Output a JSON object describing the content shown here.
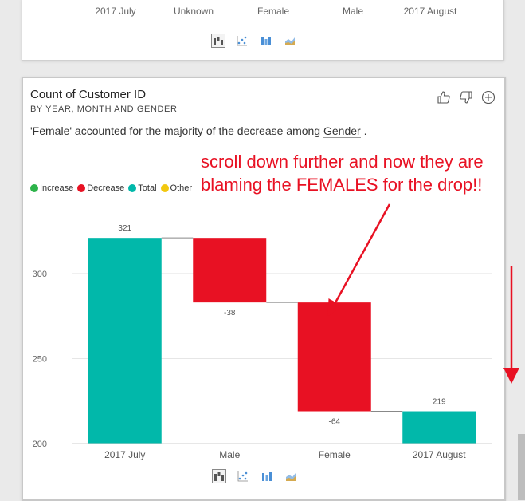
{
  "top_card": {
    "categories": [
      "2017 July",
      "Unknown",
      "Female",
      "Male",
      "2017 August"
    ]
  },
  "card": {
    "title": "Count of Customer ID",
    "subtitle": "BY YEAR, MONTH AND GENDER",
    "insight_prefix": "'Female' accounted for the majority of the decrease among ",
    "insight_keyword": "Gender",
    "insight_suffix": " .",
    "actions": [
      "thumbs-up-icon",
      "thumbs-down-icon",
      "plus-circle-icon"
    ],
    "viz_types": [
      "waterfall-icon",
      "scatter-icon",
      "column-icon",
      "area-icon"
    ],
    "legend": [
      {
        "label": "Increase",
        "color": "#2db34a"
      },
      {
        "label": "Decrease",
        "color": "#e81123"
      },
      {
        "label": "Total",
        "color": "#01b8aa"
      },
      {
        "label": "Other",
        "color": "#f2c80f"
      }
    ]
  },
  "annotation": {
    "text": "scroll down further and now they are blaming the FEMALES for the drop!!",
    "color": "#e81123"
  },
  "chart_data": {
    "type": "bar",
    "subtype": "waterfall",
    "categories": [
      "2017 July",
      "Male",
      "Female",
      "2017 August"
    ],
    "values": [
      321,
      -38,
      -64,
      219
    ],
    "value_labels": [
      "321",
      "-38",
      "-64",
      "219"
    ],
    "kinds": [
      "total",
      "decrease",
      "decrease",
      "total"
    ],
    "y_ticks": [
      200,
      250,
      300
    ],
    "ylim": [
      200,
      330
    ],
    "grid": true,
    "legend_position": "top-left",
    "colors": {
      "total": "#01b8aa",
      "decrease": "#e81123",
      "increase": "#2db34a",
      "other": "#f2c80f"
    }
  }
}
